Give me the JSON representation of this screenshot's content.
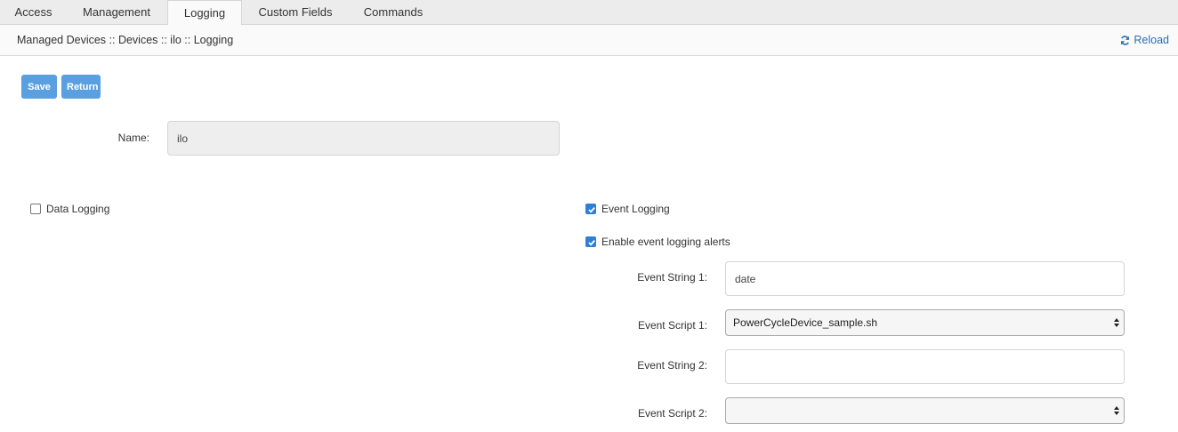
{
  "tabs": [
    {
      "label": "Access"
    },
    {
      "label": "Management"
    },
    {
      "label": "Logging"
    },
    {
      "label": "Custom Fields"
    },
    {
      "label": "Commands"
    }
  ],
  "active_tab": "Logging",
  "breadcrumb": "Managed Devices :: Devices :: ilo :: Logging",
  "reload_label": "Reload",
  "buttons": {
    "save": "Save",
    "return": "Return"
  },
  "name": {
    "label": "Name:",
    "value": "ilo"
  },
  "data_logging": {
    "label": "Data Logging",
    "checked": false
  },
  "event_logging": {
    "label": "Event Logging",
    "checked": true
  },
  "event_alerts": {
    "label": "Enable event logging alerts",
    "checked": true
  },
  "event_fields": {
    "string1_label": "Event String 1:",
    "string1_value": "date",
    "script1_label": "Event Script 1:",
    "script1_value": "PowerCycleDevice_sample.sh",
    "string2_label": "Event String 2:",
    "string2_value": "",
    "script2_label": "Event Script 2:",
    "script2_value": ""
  },
  "colors": {
    "accent": "#5aa0e1",
    "link": "#2a6fb3",
    "checkbox": "#2f7fd6"
  }
}
